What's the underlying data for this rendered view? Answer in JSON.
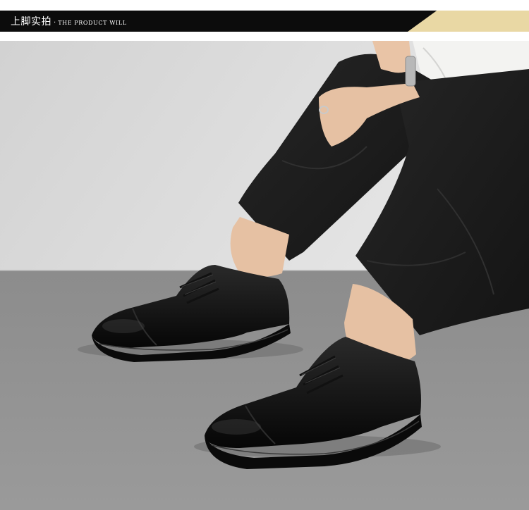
{
  "header": {
    "title_cn": "上脚实拍",
    "separator": "·",
    "title_en": "THE PRODUCT WILL"
  },
  "colors": {
    "header_bar": "#0c0c0c",
    "accent_gold": "#e9d8a4",
    "wall": "#d7d7d7",
    "floor": "#8f8f8f",
    "shoe": "#121212",
    "trousers": "#1d1d1d",
    "skin": "#e6c1a3"
  },
  "photo": {
    "subject": "black-leather-cap-toe-derby-shoes"
  }
}
